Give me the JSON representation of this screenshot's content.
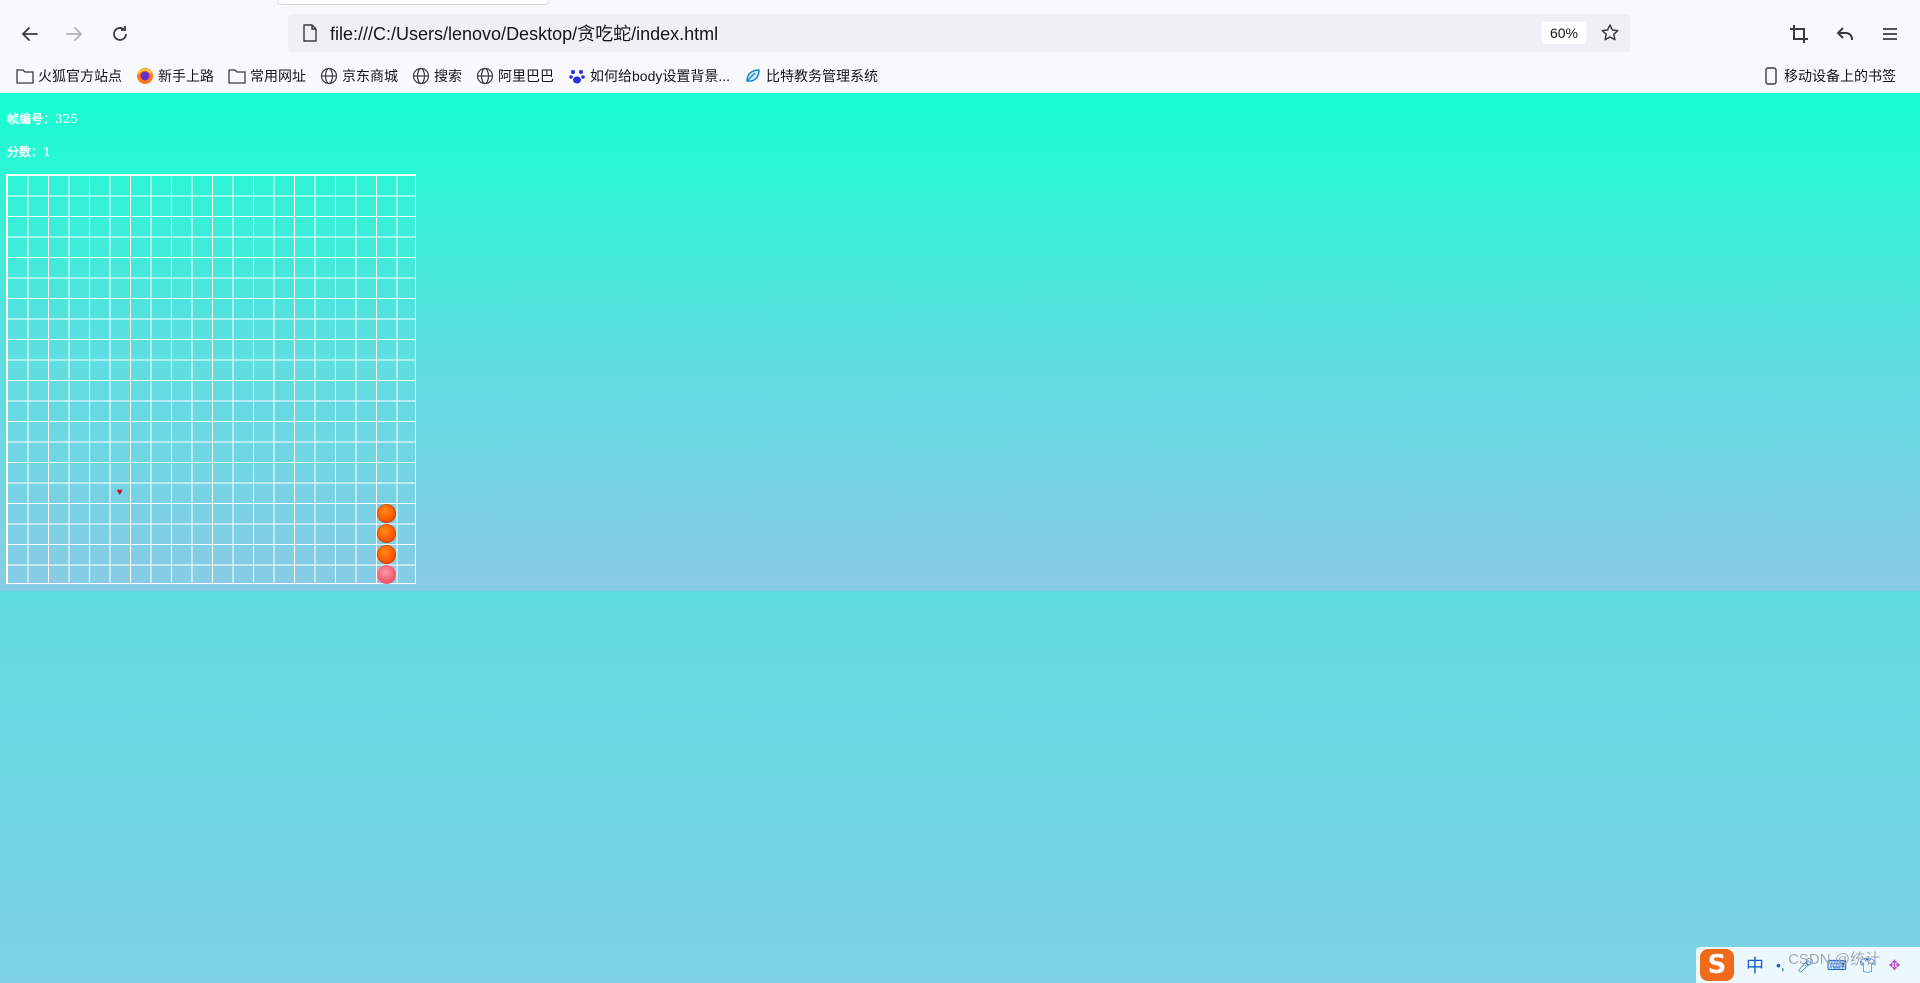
{
  "browser": {
    "url": "file:///C:/Users/lenovo/Desktop/贪吃蛇/index.html",
    "zoom": "60%",
    "bookmarks": [
      {
        "label": "火狐官方站点",
        "icon": "folder-icon"
      },
      {
        "label": "新手上路",
        "icon": "firefox-icon"
      },
      {
        "label": "常用网址",
        "icon": "folder-icon"
      },
      {
        "label": "京东商城",
        "icon": "globe-icon"
      },
      {
        "label": "搜索",
        "icon": "globe-icon"
      },
      {
        "label": "阿里巴巴",
        "icon": "globe-icon"
      },
      {
        "label": "如何给body设置背景...",
        "icon": "baidu-paw-icon"
      },
      {
        "label": "比特教务管理系统",
        "icon": "leaf-icon"
      }
    ],
    "mobile_bookmarks": "移动设备上的书签"
  },
  "game": {
    "frame_label": "帧编号：",
    "frame_value": "325",
    "score_label": "分数：",
    "score_value": "1",
    "grid_size": 20,
    "food": {
      "col": 5,
      "row": 15
    },
    "snake": [
      {
        "col": 18,
        "row": 19,
        "head": true
      },
      {
        "col": 18,
        "row": 18,
        "head": false
      },
      {
        "col": 18,
        "row": 17,
        "head": false
      },
      {
        "col": 18,
        "row": 16,
        "head": false
      }
    ],
    "colors": {
      "background_top": "#16ffd0",
      "background_bottom": "#8acbe6",
      "grid": "#ffffff",
      "snake_body": "#ff5a00",
      "snake_head": "#f45a72",
      "food": "#c01030"
    }
  },
  "taskbar": {
    "ime_logo": "S",
    "ime_lang": "中",
    "watermark": "CSDN @统计"
  }
}
